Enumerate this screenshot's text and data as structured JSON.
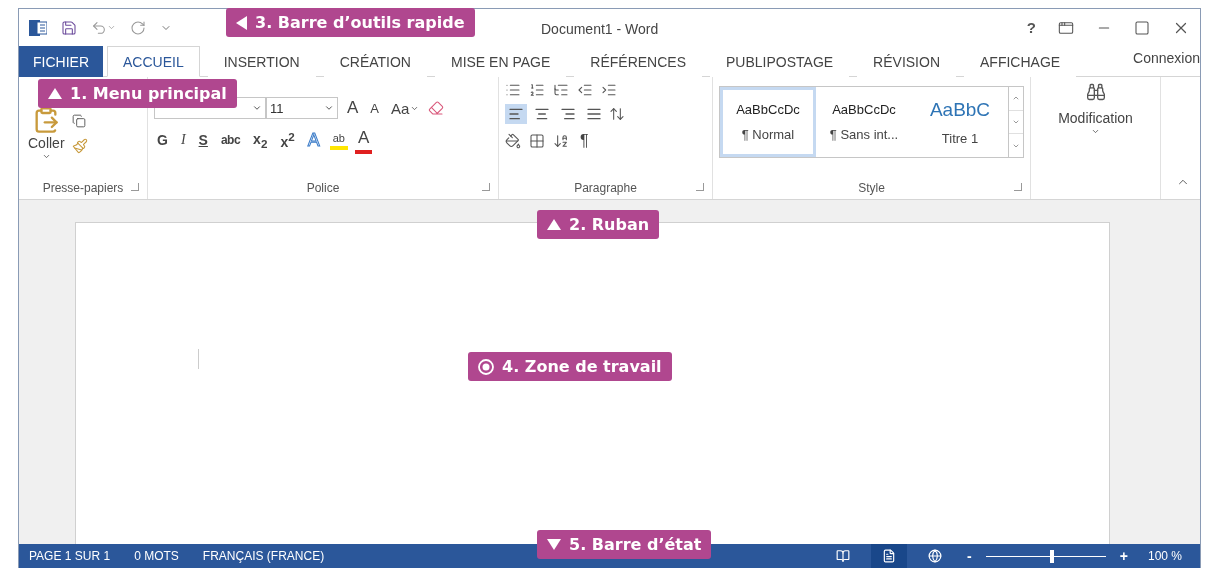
{
  "window": {
    "title": "Document1 - Word",
    "help": "?"
  },
  "tabs": [
    {
      "label": "FICHIER",
      "kind": "file",
      "selected": false
    },
    {
      "label": "ACCUEIL",
      "kind": "tab",
      "selected": true
    },
    {
      "label": "INSERTION",
      "kind": "tab",
      "selected": false
    },
    {
      "label": "CRÉATION",
      "kind": "tab",
      "selected": false
    },
    {
      "label": "MISE EN PAGE",
      "kind": "tab",
      "selected": false
    },
    {
      "label": "RÉFÉRENCES",
      "kind": "tab",
      "selected": false
    },
    {
      "label": "PUBLIPOSTAGE",
      "kind": "tab",
      "selected": false
    },
    {
      "label": "RÉVISION",
      "kind": "tab",
      "selected": false
    },
    {
      "label": "AFFICHAGE",
      "kind": "tab",
      "selected": false
    }
  ],
  "account": "Connexion",
  "ribbon": {
    "clipboard": {
      "label": "Presse-papiers",
      "paste": "Coller"
    },
    "font": {
      "label": "Police",
      "size": "11",
      "grow": "A",
      "shrink": "A",
      "case": "Aa",
      "formats": [
        {
          "label": "G",
          "kind": "bold"
        },
        {
          "label": "I",
          "kind": "italic"
        },
        {
          "label": "S",
          "kind": "underline"
        },
        {
          "label": "abc",
          "kind": "strike"
        },
        {
          "label": "x$_{2}$",
          "kind": "sub"
        },
        {
          "label": "x$^{2}$",
          "kind": "sup"
        }
      ],
      "effects": [
        {
          "label": "A",
          "kind": "effect"
        },
        {
          "label": "ab",
          "kind": "highlight"
        },
        {
          "label": "A",
          "kind": "color"
        }
      ]
    },
    "paragraph": {
      "label": "Paragraphe",
      "marks": "¶",
      "align": [
        {
          "kind": "left",
          "selected": true
        },
        {
          "kind": "center",
          "selected": false
        },
        {
          "kind": "right",
          "selected": false
        },
        {
          "kind": "justify",
          "selected": false
        }
      ]
    },
    "style": {
      "label": "Style",
      "styles": [
        {
          "sample": "AaBbCcDc",
          "name": "¶ Normal",
          "kind": "body",
          "selected": true
        },
        {
          "sample": "AaBbCcDc",
          "name": "¶ Sans int...",
          "kind": "body",
          "selected": false
        },
        {
          "sample": "AaBbC",
          "name": "Titre 1",
          "kind": "heading",
          "selected": false
        }
      ]
    },
    "editing": {
      "label": "Modification"
    }
  },
  "callouts": [
    {
      "text": "3. Barre d’outils rapide",
      "kind": "left"
    },
    {
      "text": "1. Menu principal",
      "kind": "up"
    },
    {
      "text": "2. Ruban",
      "kind": "up"
    },
    {
      "text": "4. Zone de travail",
      "kind": "target"
    },
    {
      "text": "5. Barre d’état",
      "kind": "down"
    }
  ],
  "status_bar": {
    "items": [
      "PAGE 1 SUR 1",
      "0 MOTS",
      "FRANÇAIS (FRANCE)"
    ],
    "views": [
      {
        "kind": "read",
        "selected": false
      },
      {
        "kind": "print",
        "selected": true
      },
      {
        "kind": "web",
        "selected": false
      }
    ],
    "zoom": {
      "minus": "-",
      "plus": "+",
      "level": 0.55,
      "reading": "100 %"
    }
  }
}
